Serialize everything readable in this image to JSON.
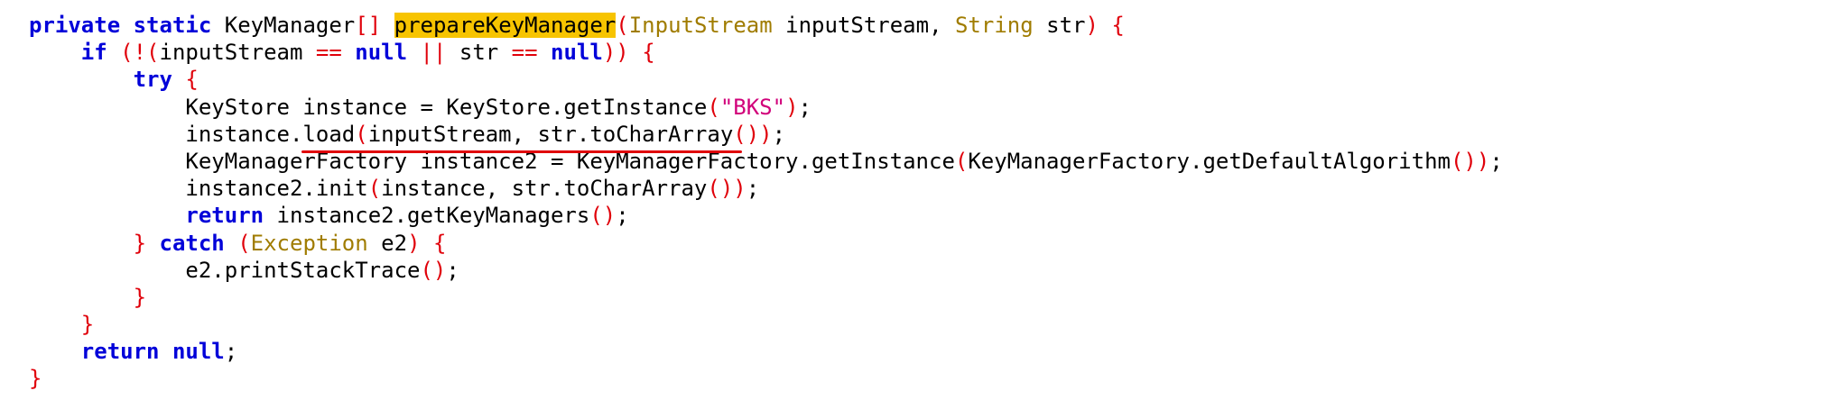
{
  "code": {
    "language": "java",
    "highlighted_method": "prepareKeyManager",
    "lines": [
      [
        {
          "t": "private",
          "k": "kw"
        },
        {
          "t": " ",
          "k": "pl"
        },
        {
          "t": "static",
          "k": "kw"
        },
        {
          "t": " KeyManager",
          "k": "pl"
        },
        {
          "t": "[]",
          "k": "br"
        },
        {
          "t": " ",
          "k": "pl"
        },
        {
          "t": "prepareKeyManager",
          "k": "hl"
        },
        {
          "t": "(",
          "k": "br"
        },
        {
          "t": "InputStream",
          "k": "ty"
        },
        {
          "t": " inputStream, ",
          "k": "pl"
        },
        {
          "t": "String",
          "k": "ty"
        },
        {
          "t": " str",
          "k": "pl"
        },
        {
          "t": ")",
          "k": "br"
        },
        {
          "t": " ",
          "k": "pl"
        },
        {
          "t": "{",
          "k": "br"
        }
      ],
      [
        {
          "t": "    ",
          "k": "pl"
        },
        {
          "t": "if",
          "k": "kw"
        },
        {
          "t": " ",
          "k": "pl"
        },
        {
          "t": "(!(",
          "k": "br"
        },
        {
          "t": "inputStream ",
          "k": "pl"
        },
        {
          "t": "==",
          "k": "br"
        },
        {
          "t": " ",
          "k": "pl"
        },
        {
          "t": "null",
          "k": "kw"
        },
        {
          "t": " ",
          "k": "pl"
        },
        {
          "t": "||",
          "k": "br"
        },
        {
          "t": " str ",
          "k": "pl"
        },
        {
          "t": "==",
          "k": "br"
        },
        {
          "t": " ",
          "k": "pl"
        },
        {
          "t": "null",
          "k": "kw"
        },
        {
          "t": "))",
          "k": "br"
        },
        {
          "t": " ",
          "k": "pl"
        },
        {
          "t": "{",
          "k": "br"
        }
      ],
      [
        {
          "t": "        ",
          "k": "pl"
        },
        {
          "t": "try",
          "k": "kw"
        },
        {
          "t": " ",
          "k": "pl"
        },
        {
          "t": "{",
          "k": "br"
        }
      ],
      [
        {
          "t": "            KeyStore instance = KeyStore.getInstance",
          "k": "pl"
        },
        {
          "t": "(",
          "k": "br"
        },
        {
          "t": "\"BKS\"",
          "k": "st"
        },
        {
          "t": ")",
          "k": "br"
        },
        {
          "t": ";",
          "k": "pl"
        }
      ],
      [
        {
          "t": "            instance.load",
          "k": "pl"
        },
        {
          "t": "(",
          "k": "br"
        },
        {
          "t": "inputStream, str.toCharArray",
          "k": "pl"
        },
        {
          "t": "())",
          "k": "br"
        },
        {
          "t": ";",
          "k": "pl"
        }
      ],
      [
        {
          "t": "            KeyManagerFactory instance2 = KeyManagerFactory.getInstance",
          "k": "pl"
        },
        {
          "t": "(",
          "k": "br"
        },
        {
          "t": "KeyManagerFactory.getDefaultAlgorithm",
          "k": "pl"
        },
        {
          "t": "())",
          "k": "br"
        },
        {
          "t": ";",
          "k": "pl"
        }
      ],
      [
        {
          "t": "            instance2.init",
          "k": "pl"
        },
        {
          "t": "(",
          "k": "br"
        },
        {
          "t": "instance, str.toCharArray",
          "k": "pl"
        },
        {
          "t": "())",
          "k": "br"
        },
        {
          "t": ";",
          "k": "pl"
        }
      ],
      [
        {
          "t": "            ",
          "k": "pl"
        },
        {
          "t": "return",
          "k": "kw"
        },
        {
          "t": " instance2.getKeyManagers",
          "k": "pl"
        },
        {
          "t": "()",
          "k": "br"
        },
        {
          "t": ";",
          "k": "pl"
        }
      ],
      [
        {
          "t": "        ",
          "k": "pl"
        },
        {
          "t": "}",
          "k": "br"
        },
        {
          "t": " ",
          "k": "pl"
        },
        {
          "t": "catch",
          "k": "kw"
        },
        {
          "t": " ",
          "k": "pl"
        },
        {
          "t": "(",
          "k": "br"
        },
        {
          "t": "Exception",
          "k": "ty"
        },
        {
          "t": " e2",
          "k": "pl"
        },
        {
          "t": ")",
          "k": "br"
        },
        {
          "t": " ",
          "k": "pl"
        },
        {
          "t": "{",
          "k": "br"
        }
      ],
      [
        {
          "t": "            e2.printStackTrace",
          "k": "pl"
        },
        {
          "t": "()",
          "k": "br"
        },
        {
          "t": ";",
          "k": "pl"
        }
      ],
      [
        {
          "t": "        ",
          "k": "pl"
        },
        {
          "t": "}",
          "k": "br"
        }
      ],
      [
        {
          "t": "    ",
          "k": "pl"
        },
        {
          "t": "}",
          "k": "br"
        }
      ],
      [
        {
          "t": "    ",
          "k": "pl"
        },
        {
          "t": "return",
          "k": "kw"
        },
        {
          "t": " ",
          "k": "pl"
        },
        {
          "t": "null",
          "k": "kw"
        },
        {
          "t": ";",
          "k": "pl"
        }
      ],
      [
        {
          "t": "}",
          "k": "br"
        }
      ]
    ]
  },
  "annotation": {
    "underlined_text": "load(inputStream, str.toCharArray())",
    "underline_color": "#e0000a"
  },
  "colors": {
    "background": "#ffffff",
    "keyword": "#0000d9",
    "bracket": "#e0000a",
    "type": "#a07c00",
    "string": "#d1007a",
    "highlight": "#f7c400"
  }
}
